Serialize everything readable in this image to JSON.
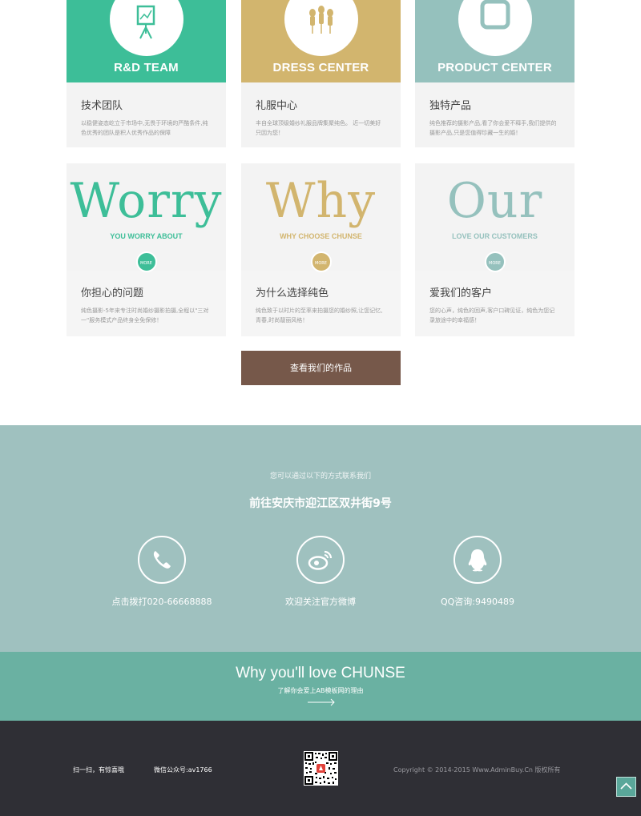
{
  "colors": {
    "green": "#3dbe98",
    "gold": "#d2b56e",
    "teal": "#95c1bd",
    "brown": "#76584a",
    "contact_bg": "#9fc1bf",
    "why_bg": "#6ab1a2",
    "footer_bg": "#2f2f35"
  },
  "top_cards": [
    {
      "head": "R&D TEAM",
      "title": "技术团队",
      "desc": "以稳健姿态屹立于市场中,无畏于环境的严酷条件,纯色优秀的团队是积人优秀作品的保障",
      "icon": "easel-chart-icon"
    },
    {
      "head": "DRESS CENTER",
      "title": "礼服中心",
      "desc": "丰自全球顶级婚纱礼服品牌集聚纯色。 近一切美好只因为您！",
      "icon": "mannequins-icon"
    },
    {
      "head": "PRODUCT CENTER",
      "title": "独特产品",
      "desc": "纯色推荐的摄影产品,看了你会爱不释手,我们提供的摄影产品,只是您值得珍藏一生的婚！",
      "icon": "square-frame-icon"
    }
  ],
  "bottom_cards": [
    {
      "big": "Worry",
      "sub": "YOU WORRY ABOUT",
      "more": "MORE",
      "title": "你担心的问题",
      "desc": "纯色摄影-5年来专注时尚婚纱摄影拍摄,全程以\"三对一\"服务模式产品终身全免保修！"
    },
    {
      "big": "Why",
      "sub": "WHY CHOOSE CHUNSE",
      "more": "MORE",
      "title": "为什么选择纯色",
      "desc": "纯色致于以时片的至率来拍摄您的婚纱照,让您记忆,青春,时尚靓丽风格！"
    },
    {
      "big": "Our",
      "sub": "LOVE OUR CUSTOMERS",
      "more": "MORE",
      "title": "爱我们的客户",
      "desc": "您的心声，纯色的回声,客户口碑见证，纯色为您记录旅途中的幸福感！"
    }
  ],
  "works_button": "查看我们的作品",
  "contact": {
    "intro": "您可以通过以下的方式联系我们",
    "address": "前往安庆市迎江区双井街9号",
    "items": [
      {
        "label": "点击拨打020-66668888",
        "icon": "phone-icon"
      },
      {
        "label": "欢迎关注官方微博",
        "icon": "weibo-icon"
      },
      {
        "label": "QQ咨询:9490489",
        "icon": "qq-penguin-icon"
      }
    ]
  },
  "why": {
    "title": "Why you'll love CHUNSE",
    "subtitle": "了解你会爱上AB模板网的理由"
  },
  "footer": {
    "scan": "扫一扫，有惊喜哦",
    "wechat": "微信公众号:av1766",
    "copyright": "Copyright © 2014-2015 Www.AdminBuy.Cn 版权所有"
  }
}
